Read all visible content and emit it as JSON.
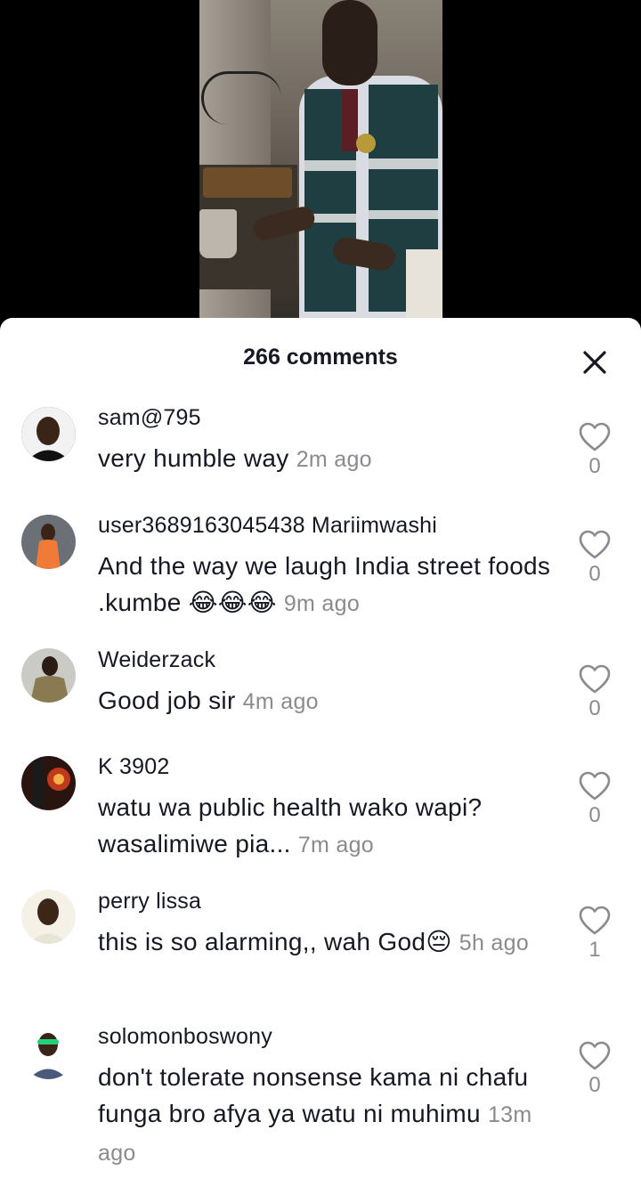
{
  "sheet": {
    "comment_count": "266 comments",
    "close_icon": "close-icon"
  },
  "comments": [
    {
      "username": "sam@795",
      "text": "very humble way",
      "time": "2m ago",
      "likes": "0"
    },
    {
      "username": "user3689163045438 Mariimwashi",
      "text": "And the way we laugh India street foods .kumbe 😂😂😂",
      "time": "9m ago",
      "likes": "0"
    },
    {
      "username": "Weiderzack",
      "text": "Good job sir",
      "time": "4m ago",
      "likes": "0"
    },
    {
      "username": "K 3902",
      "text": "watu wa public health wako wapi? wasalimiwe pia...",
      "time": "7m ago",
      "likes": "0"
    },
    {
      "username": "perry lissa",
      "text": "this is so alarming,, wah God😔",
      "time": "5h ago",
      "likes": "1"
    },
    {
      "username": "solomonboswony",
      "text": "don't tolerate nonsense kama ni chafu funga bro afya ya watu ni muhimu",
      "time": "13m ago",
      "likes": "0"
    }
  ],
  "colors": {
    "text": "#161823",
    "muted": "#8a8b91",
    "background": "#ffffff"
  }
}
